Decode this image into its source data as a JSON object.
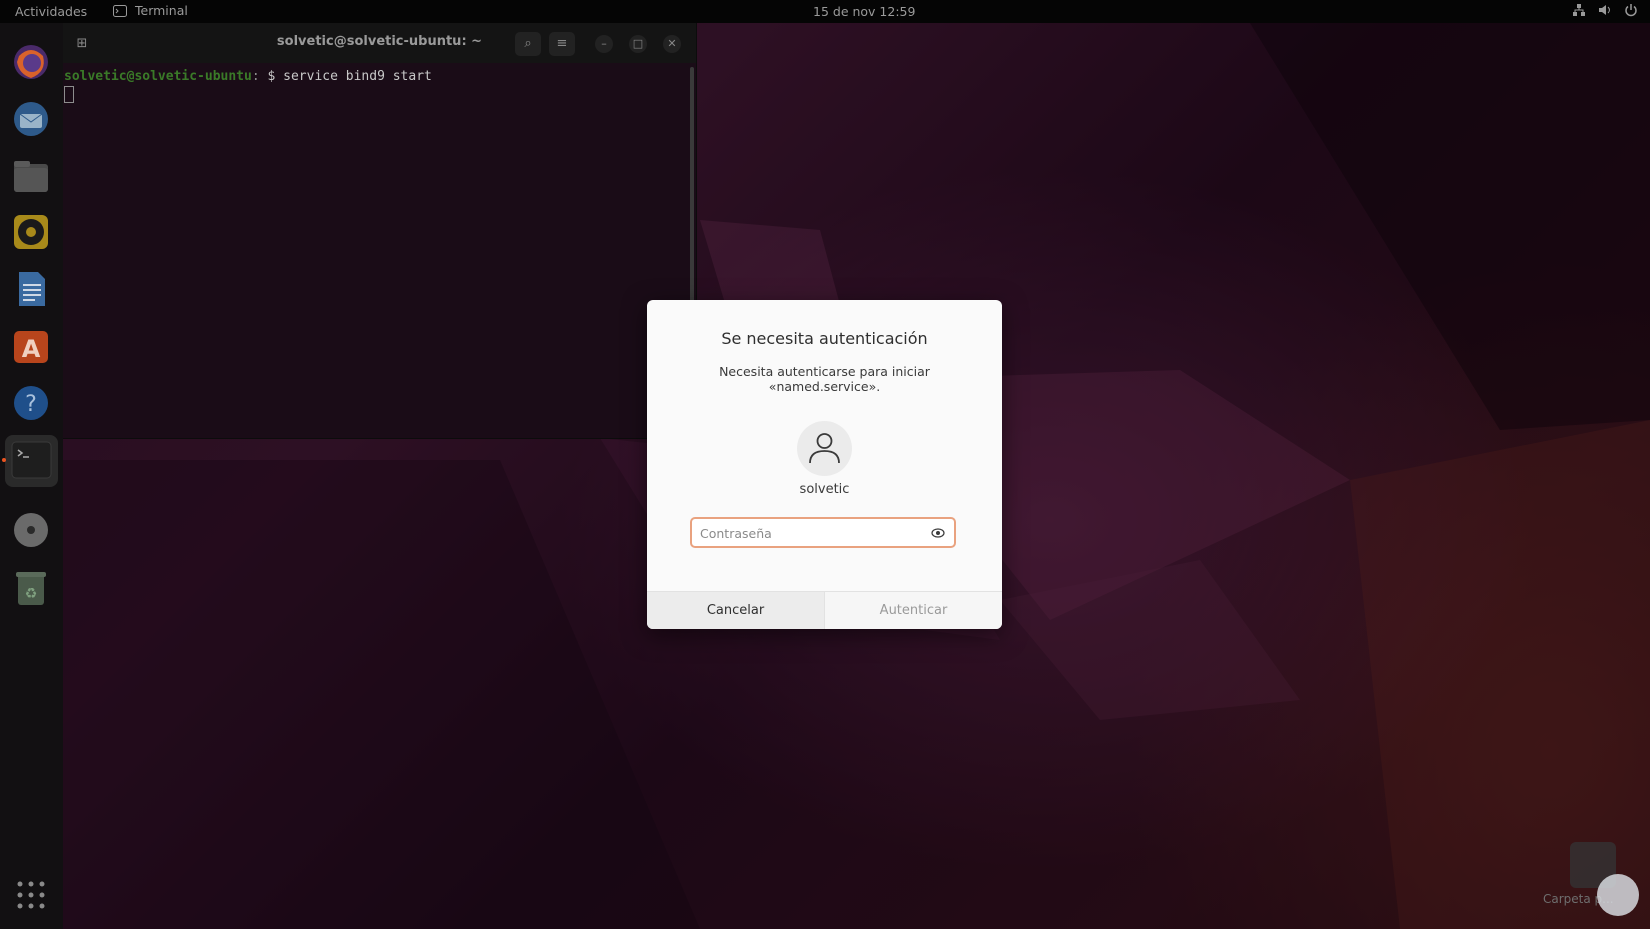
{
  "topbar": {
    "activities": "Actividades",
    "app_name": "Terminal",
    "clock": "15 de nov  12:59"
  },
  "terminal": {
    "title": "solvetic@solvetic-ubuntu: ~",
    "prompt_user": "solvetic@solvetic-ubuntu",
    "prompt_path": ": ",
    "command": "$ service bind9 start"
  },
  "dock": {
    "items": [
      "firefox",
      "thunderbird",
      "files",
      "rhythmbox",
      "libreoffice-writer",
      "software",
      "help",
      "terminal",
      "optical-drive",
      "trash",
      "show-apps"
    ]
  },
  "dialog": {
    "title": "Se necesita autenticación",
    "message_line1": "Necesita autenticarse para iniciar",
    "message_line2": "«named.service».",
    "username": "solvetic",
    "password_placeholder": "Contraseña",
    "cancel_label": "Cancelar",
    "authenticate_label": "Autenticar"
  },
  "desktop": {
    "home_label": "Carpeta p..."
  },
  "colors": {
    "accent": "#e95420",
    "focus_border": "#e9a27f"
  }
}
